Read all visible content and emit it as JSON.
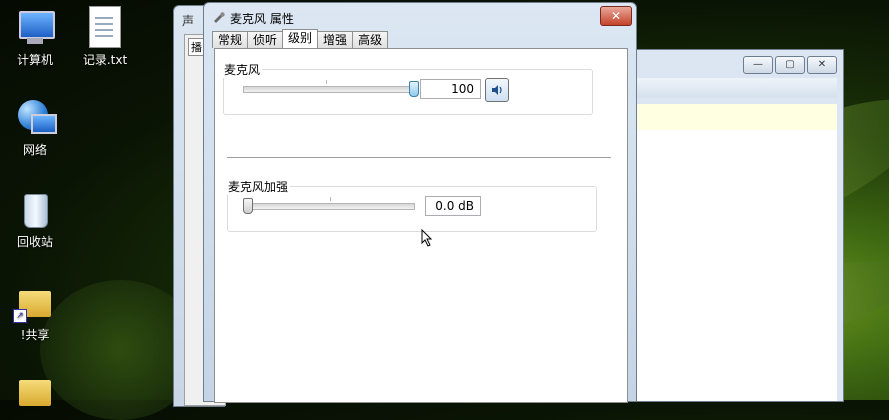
{
  "desktop": {
    "icons": [
      {
        "label": "计算机",
        "icon": "computer-icon"
      },
      {
        "label": "记录.txt",
        "icon": "text-file-icon"
      },
      {
        "label": "网络",
        "icon": "network-icon"
      },
      {
        "label": "回收站",
        "icon": "recycle-bin-icon"
      },
      {
        "label": "!共享",
        "icon": "shared-folder-icon"
      }
    ]
  },
  "back_window": {
    "title": "声",
    "tab": "播"
  },
  "explorer": {
    "buttons": {
      "minimize": "—",
      "maximize": "▢",
      "close": "✕"
    }
  },
  "dialog": {
    "title": "麦克风 属性",
    "close_label": "✕",
    "tabs": [
      "常规",
      "侦听",
      "级别",
      "增强",
      "高级"
    ],
    "active_tab": "级别",
    "microphone": {
      "label": "麦克风",
      "level": 100,
      "value_text": "100"
    },
    "boost": {
      "label": "麦克风加强",
      "level_db": 0.0,
      "value_text": "0.0 dB"
    }
  },
  "colors": {
    "accent": "#3c7fb1",
    "info_bar": "#ffffe1"
  }
}
